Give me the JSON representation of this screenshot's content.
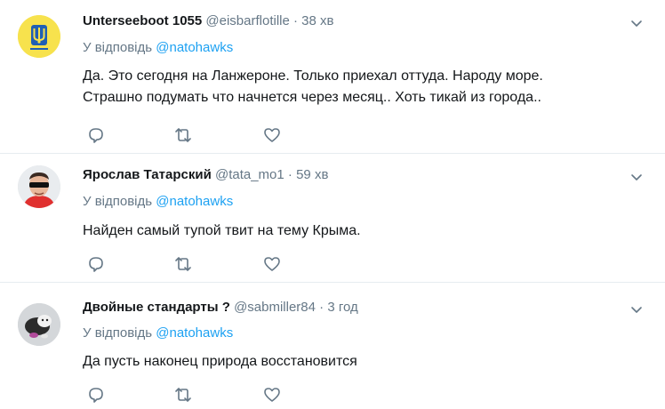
{
  "tweets": [
    {
      "name": "Unterseeboot 1055",
      "handle": "@eisbarflotille",
      "dot": "·",
      "time": "38 хв",
      "reply_prefix": "У відповідь",
      "reply_to": "@natohawks",
      "lines": [
        "Да. Это сегодня на Ланжероне. Только приехал оттуда. Народу море.",
        "Страшно подумать что начнется через месяц.. Хоть тикай из города.."
      ]
    },
    {
      "name": "Ярослав Татарский",
      "handle": "@tata_mo1",
      "dot": "·",
      "time": "59 хв",
      "reply_prefix": "У відповідь",
      "reply_to": "@natohawks",
      "lines": [
        "Найден самый тупой твит на тему Крыма."
      ]
    },
    {
      "name": "Двойные стандарты ?",
      "handle": "@sabmiller84",
      "dot": "·",
      "time": "3 год",
      "reply_prefix": "У відповідь",
      "reply_to": "@natohawks",
      "lines": [
        "Да пусть наконец природа восстановится"
      ]
    }
  ],
  "icons": {
    "reply": "reply-icon",
    "retweet": "retweet-icon",
    "like": "like-icon",
    "menu": "chevron-down-icon"
  },
  "colors": {
    "link": "#1da1f2",
    "muted": "#657786",
    "text": "#14171a",
    "divider": "#e6ecf0"
  }
}
